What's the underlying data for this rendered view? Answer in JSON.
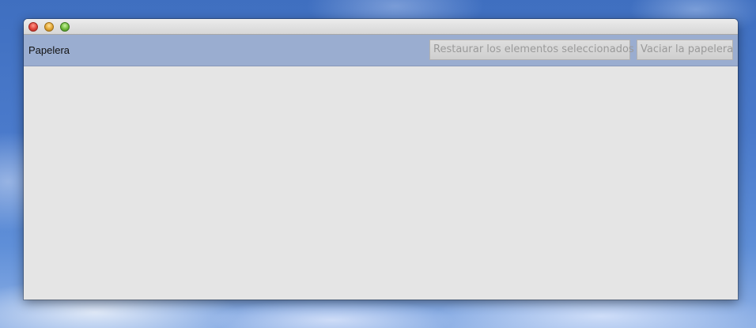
{
  "window": {
    "toolbar": {
      "title": "Papelera",
      "restore_label": "Restaurar los elementos seleccionados",
      "empty_label": "Vaciar la papelera"
    }
  },
  "colors": {
    "toolbar_bg": "#9aadd0",
    "content_bg": "#e5e5e5",
    "disabled_text": "#9a9a9a"
  }
}
